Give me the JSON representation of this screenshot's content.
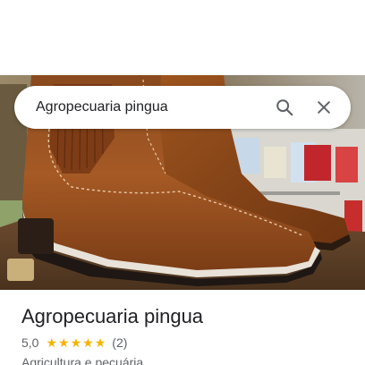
{
  "search": {
    "query": "Agropecuaria pingua"
  },
  "icons": {
    "search": "search-icon",
    "close": "close-icon",
    "star": "star-icon"
  },
  "photo": {
    "description_icon": "boots-photo"
  },
  "place": {
    "name": "Agropecuaria pingua",
    "rating_value": "5,0",
    "rating_stars": 5,
    "review_count": "(2)",
    "category": "Agricultura e pecuária"
  },
  "colors": {
    "star": "#f4b400",
    "text_primary": "#202124",
    "text_secondary": "#5f6368"
  }
}
